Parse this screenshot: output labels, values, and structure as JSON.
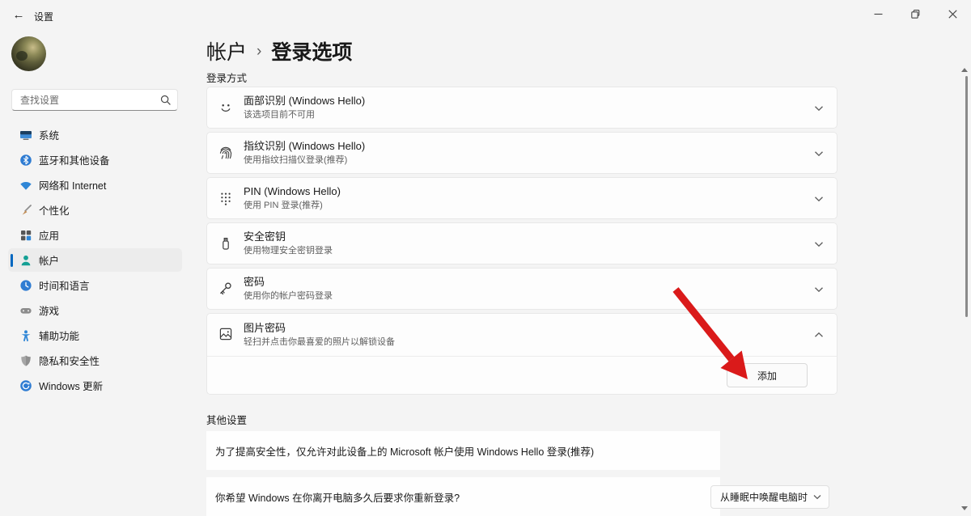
{
  "titlebar": {
    "back_glyph": "←",
    "title": "设置"
  },
  "colors": {
    "accent": "#0067c0",
    "arrow_red": "#da1a1a"
  },
  "sidebar": {
    "search_placeholder": "查找设置",
    "items": [
      {
        "label": "系统",
        "icon": "system-icon"
      },
      {
        "label": "蓝牙和其他设备",
        "icon": "bluetooth-icon"
      },
      {
        "label": "网络和 Internet",
        "icon": "network-icon"
      },
      {
        "label": "个性化",
        "icon": "personalization-icon"
      },
      {
        "label": "应用",
        "icon": "apps-icon"
      },
      {
        "label": "帐户",
        "icon": "accounts-icon",
        "selected": true
      },
      {
        "label": "时间和语言",
        "icon": "time-language-icon"
      },
      {
        "label": "游戏",
        "icon": "gaming-icon"
      },
      {
        "label": "辅助功能",
        "icon": "accessibility-icon"
      },
      {
        "label": "隐私和安全性",
        "icon": "privacy-icon"
      },
      {
        "label": "Windows 更新",
        "icon": "windows-update-icon"
      }
    ]
  },
  "header": {
    "breadcrumb_parent": "帐户",
    "breadcrumb_separator": "›",
    "page_title": "登录选项"
  },
  "main": {
    "section_sign_in": "登录方式",
    "rows": [
      {
        "title": "面部识别 (Windows Hello)",
        "subtitle": "该选项目前不可用",
        "icon": "face-icon",
        "expanded": false
      },
      {
        "title": "指纹识别 (Windows Hello)",
        "subtitle": "使用指纹扫描仪登录(推荐)",
        "icon": "fingerprint-icon",
        "expanded": false
      },
      {
        "title": "PIN (Windows Hello)",
        "subtitle": "使用 PIN 登录(推荐)",
        "icon": "pin-keypad-icon",
        "expanded": false
      },
      {
        "title": "安全密钥",
        "subtitle": "使用物理安全密钥登录",
        "icon": "security-key-icon",
        "expanded": false
      },
      {
        "title": "密码",
        "subtitle": "使用你的帐户密码登录",
        "icon": "password-key-icon",
        "expanded": false
      },
      {
        "title": "图片密码",
        "subtitle": "轻扫并点击你最喜爱的照片以解锁设备",
        "icon": "picture-password-icon",
        "expanded": true
      }
    ],
    "picture_password": {
      "add_button": "添加"
    },
    "section_additional": "其他设置",
    "hello_only_text": "为了提高安全性，仅允许对此设备上的 Microsoft 帐户使用 Windows Hello 登录(推荐)",
    "sign_in_again_label": "你希望 Windows 在你离开电脑多久后要求你重新登录?",
    "sign_in_again_value": "从睡眠中唤醒电脑时"
  }
}
